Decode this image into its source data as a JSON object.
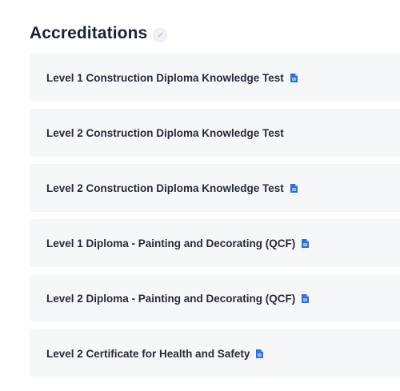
{
  "section": {
    "title": "Accreditations",
    "edit_icon": "pencil-icon"
  },
  "accreditations": [
    {
      "label": "Level 1 Construction Diploma Knowledge Test",
      "has_document": true
    },
    {
      "label": "Level 2 Construction Diploma Knowledge Test",
      "has_document": false
    },
    {
      "label": "Level 2 Construction Diploma Knowledge Test",
      "has_document": true
    },
    {
      "label": "Level 1 Diploma - Painting and Decorating (QCF)",
      "has_document": true
    },
    {
      "label": "Level 2 Diploma - Painting and Decorating (QCF)",
      "has_document": true
    },
    {
      "label": "Level 2 Certificate for Health and Safety",
      "has_document": true
    }
  ],
  "colors": {
    "document_icon": "#2f6fe0",
    "row_background": "#f6f7f9",
    "title_text": "#1d2233"
  }
}
